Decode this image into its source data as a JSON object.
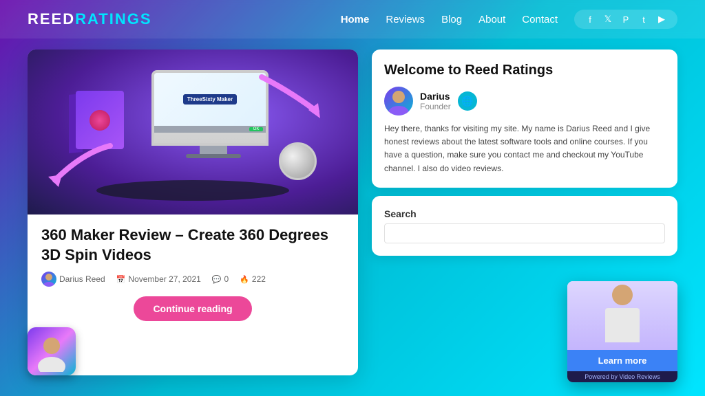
{
  "header": {
    "logo_text": "ReedRatings",
    "nav_items": [
      {
        "label": "Home",
        "active": true
      },
      {
        "label": "Reviews",
        "active": false
      },
      {
        "label": "Blog",
        "active": false
      },
      {
        "label": "About",
        "active": false
      },
      {
        "label": "Contact",
        "active": false
      }
    ],
    "social_icons": [
      "f",
      "t",
      "p",
      "t",
      "yt"
    ]
  },
  "article": {
    "title": "360 Maker Review – Create 360 Degrees 3D Spin Videos",
    "author": "Darius Reed",
    "date": "November 27, 2021",
    "comments": "0",
    "views": "222",
    "continue_btn": "Continue reading"
  },
  "sidebar": {
    "welcome_title": "Welcome to Reed Ratings",
    "author_name": "Darius",
    "author_role": "Founder",
    "author_bio": "Hey there, thanks for visiting my site. My name is Darius Reed and I give honest reviews about the latest software tools and online courses. If you have a question, make sure you contact me and checkout my YouTube channel. I also do video reviews.",
    "search_label": "Search",
    "search_placeholder": ""
  },
  "video_widget": {
    "learn_btn": "Learn more",
    "powered_text": "Powered by Video Reviews"
  }
}
